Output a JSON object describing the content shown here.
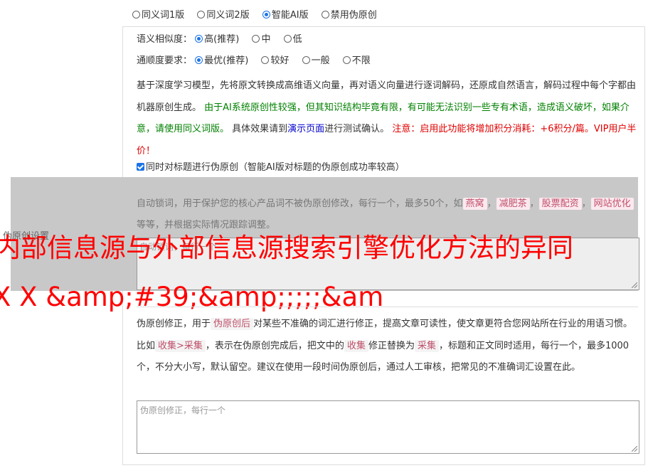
{
  "modes": [
    {
      "label": "同义词1版",
      "selected": false
    },
    {
      "label": "同义词2版",
      "selected": false
    },
    {
      "label": "智能AI版",
      "selected": true
    },
    {
      "label": "禁用伪原创",
      "selected": false
    }
  ],
  "similarity": {
    "label": "语义相似度：",
    "options": [
      {
        "label": "高(推荐)",
        "selected": true
      },
      {
        "label": "中",
        "selected": false
      },
      {
        "label": "低",
        "selected": false
      }
    ]
  },
  "fluency": {
    "label": "通顺度要求：",
    "options": [
      {
        "label": "最优(推荐)",
        "selected": true
      },
      {
        "label": "较好",
        "selected": false
      },
      {
        "label": "一般",
        "selected": false
      },
      {
        "label": "不限",
        "selected": false
      }
    ]
  },
  "description": {
    "intro": "基于深度学习模型，先将原文转换成高维语义向量，再对语义向量进行逐词解码，还原成自然语言，解码过程中每个字都由机器原创生成。 ",
    "warning_green": "由于AI系统原创性较强，但其知识结构毕竟有限，有可能无法识别一些专有术语，造成语义破坏，如果介意，请使用同义词版。",
    "test_prefix": " 具体效果请到",
    "demo_link": "演示页面",
    "test_suffix": "进行测试确认。 ",
    "notice_red": "注意：启用此功能将增加积分消耗：+6积分/篇。VIP用户半价！"
  },
  "title_checkbox": {
    "label": "同时对标题进行伪原创（智能AI版对标题的伪原创成功率较高）",
    "checked": true
  },
  "section_label": "伪原创设置",
  "lock_words": {
    "text_before": "自动锁词，用于保护您的核心产品词不被伪原创修改，每行一个，最多50个，如",
    "examples": [
      "燕窝",
      "减肥茶",
      "股票配资",
      "网站优化"
    ],
    "separator": "，",
    "text_after": "等等，并根据实际情况跟踪调整。",
    "placeholder": "自动锁词，每行一个"
  },
  "headline": {
    "line1": "内部信息源与外部信息源搜索引擎优化方法的异同",
    "line2": "X X &amp;#39;&amp;;;;;&am"
  },
  "correction": {
    "text1": "伪原创修正，用于",
    "tag1": "伪原创后",
    "text2": "对某些不准确的词汇进行修正，提高文章可读性，使文章更符合您网站所在行业的用语习惯。比如",
    "tag2": "收集>采集",
    "text3": "，表示在伪原创完成后，把文中的",
    "tag3": "收集",
    "text4": "修正替换为",
    "tag4": "采集",
    "text5": "，标题和正文同时适用，每行一个，最多1000个，不分大小写，默认留空。建议在使用一段时间伪原创后，通过人工审核，把常见的不准确词汇设置在此。",
    "placeholder": "伪原创修正，每行一个"
  },
  "colors": {
    "accent": "#1a73e8",
    "green": "#008000",
    "red": "#e00000",
    "link": "#0000cc",
    "headline": "#ff0000"
  }
}
